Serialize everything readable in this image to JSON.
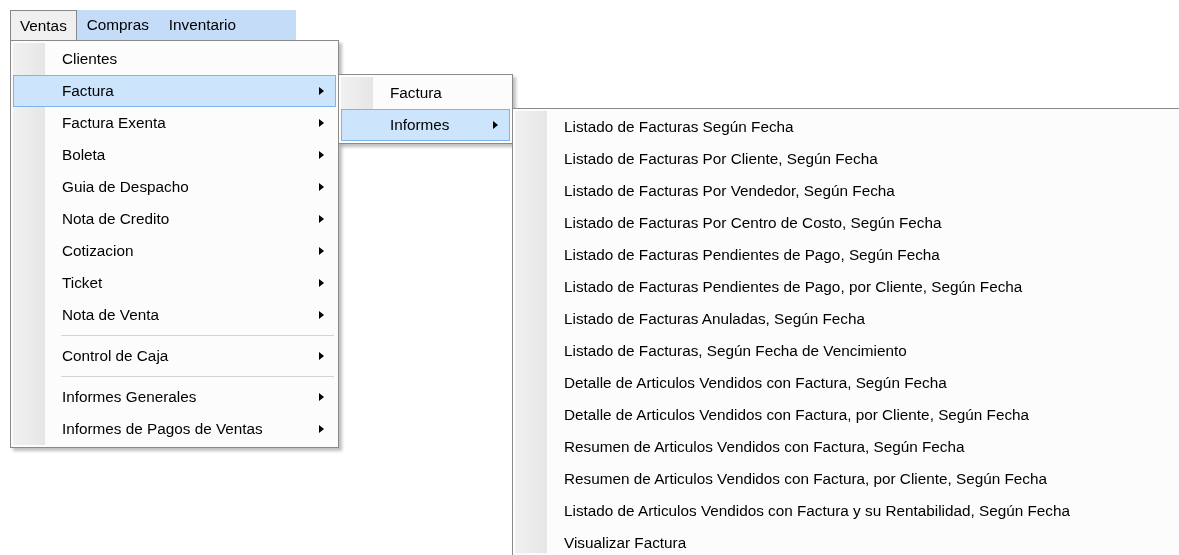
{
  "menubar": [
    {
      "label": "Ventas",
      "selected": true
    },
    {
      "label": "Compras",
      "selected": false
    },
    {
      "label": "Inventario",
      "selected": false
    }
  ],
  "menu": [
    {
      "kind": "item",
      "label": "Clientes",
      "submenu": false,
      "selected": false
    },
    {
      "kind": "item",
      "label": "Factura",
      "submenu": true,
      "selected": true
    },
    {
      "kind": "item",
      "label": "Factura Exenta",
      "submenu": true,
      "selected": false
    },
    {
      "kind": "item",
      "label": "Boleta",
      "submenu": true,
      "selected": false
    },
    {
      "kind": "item",
      "label": "Guia de Despacho",
      "submenu": true,
      "selected": false
    },
    {
      "kind": "item",
      "label": "Nota de Credito",
      "submenu": true,
      "selected": false
    },
    {
      "kind": "item",
      "label": "Cotizacion",
      "submenu": true,
      "selected": false
    },
    {
      "kind": "item",
      "label": "Ticket",
      "submenu": true,
      "selected": false
    },
    {
      "kind": "item",
      "label": "Nota de Venta",
      "submenu": true,
      "selected": false
    },
    {
      "kind": "separator"
    },
    {
      "kind": "item",
      "label": "Control de Caja",
      "submenu": true,
      "selected": false
    },
    {
      "kind": "separator"
    },
    {
      "kind": "item",
      "label": "Informes Generales",
      "submenu": true,
      "selected": false
    },
    {
      "kind": "item",
      "label": "Informes de Pagos de Ventas",
      "submenu": true,
      "selected": false
    }
  ],
  "submenu": [
    {
      "kind": "item",
      "label": "Factura",
      "submenu": false,
      "selected": false
    },
    {
      "kind": "item",
      "label": "Informes",
      "submenu": true,
      "selected": true
    }
  ],
  "informes_menu": [
    {
      "kind": "item",
      "label": "Listado de Facturas Según Fecha",
      "selected": false
    },
    {
      "kind": "item",
      "label": "Listado de Facturas Por Cliente, Según Fecha",
      "selected": false
    },
    {
      "kind": "item",
      "label": "Listado de Facturas Por Vendedor, Según Fecha",
      "selected": false
    },
    {
      "kind": "item",
      "label": "Listado de Facturas Por Centro de Costo, Según Fecha",
      "selected": false
    },
    {
      "kind": "item",
      "label": "Listado de Facturas Pendientes de Pago, Según Fecha",
      "selected": false
    },
    {
      "kind": "item",
      "label": "Listado de Facturas Pendientes de Pago, por Cliente, Según Fecha",
      "selected": false
    },
    {
      "kind": "item",
      "label": "Listado de Facturas Anuladas, Según Fecha",
      "selected": false
    },
    {
      "kind": "item",
      "label": "Listado de Facturas, Según Fecha de Vencimiento",
      "selected": false
    },
    {
      "kind": "item",
      "label": "Detalle de Articulos Vendidos con Factura, Según Fecha",
      "selected": false
    },
    {
      "kind": "item",
      "label": "Detalle de Articulos Vendidos con Factura, por Cliente,  Según Fecha",
      "selected": false
    },
    {
      "kind": "item",
      "label": "Resumen de Articulos Vendidos con Factura, Según Fecha",
      "selected": false
    },
    {
      "kind": "item",
      "label": "Resumen de Articulos Vendidos con Factura, por Cliente, Según Fecha",
      "selected": false
    },
    {
      "kind": "item",
      "label": "Listado de Articulos Vendidos con Factura y su Rentabilidad, Según Fecha",
      "selected": false
    },
    {
      "kind": "item",
      "label": "Visualizar Factura",
      "selected": false
    }
  ]
}
